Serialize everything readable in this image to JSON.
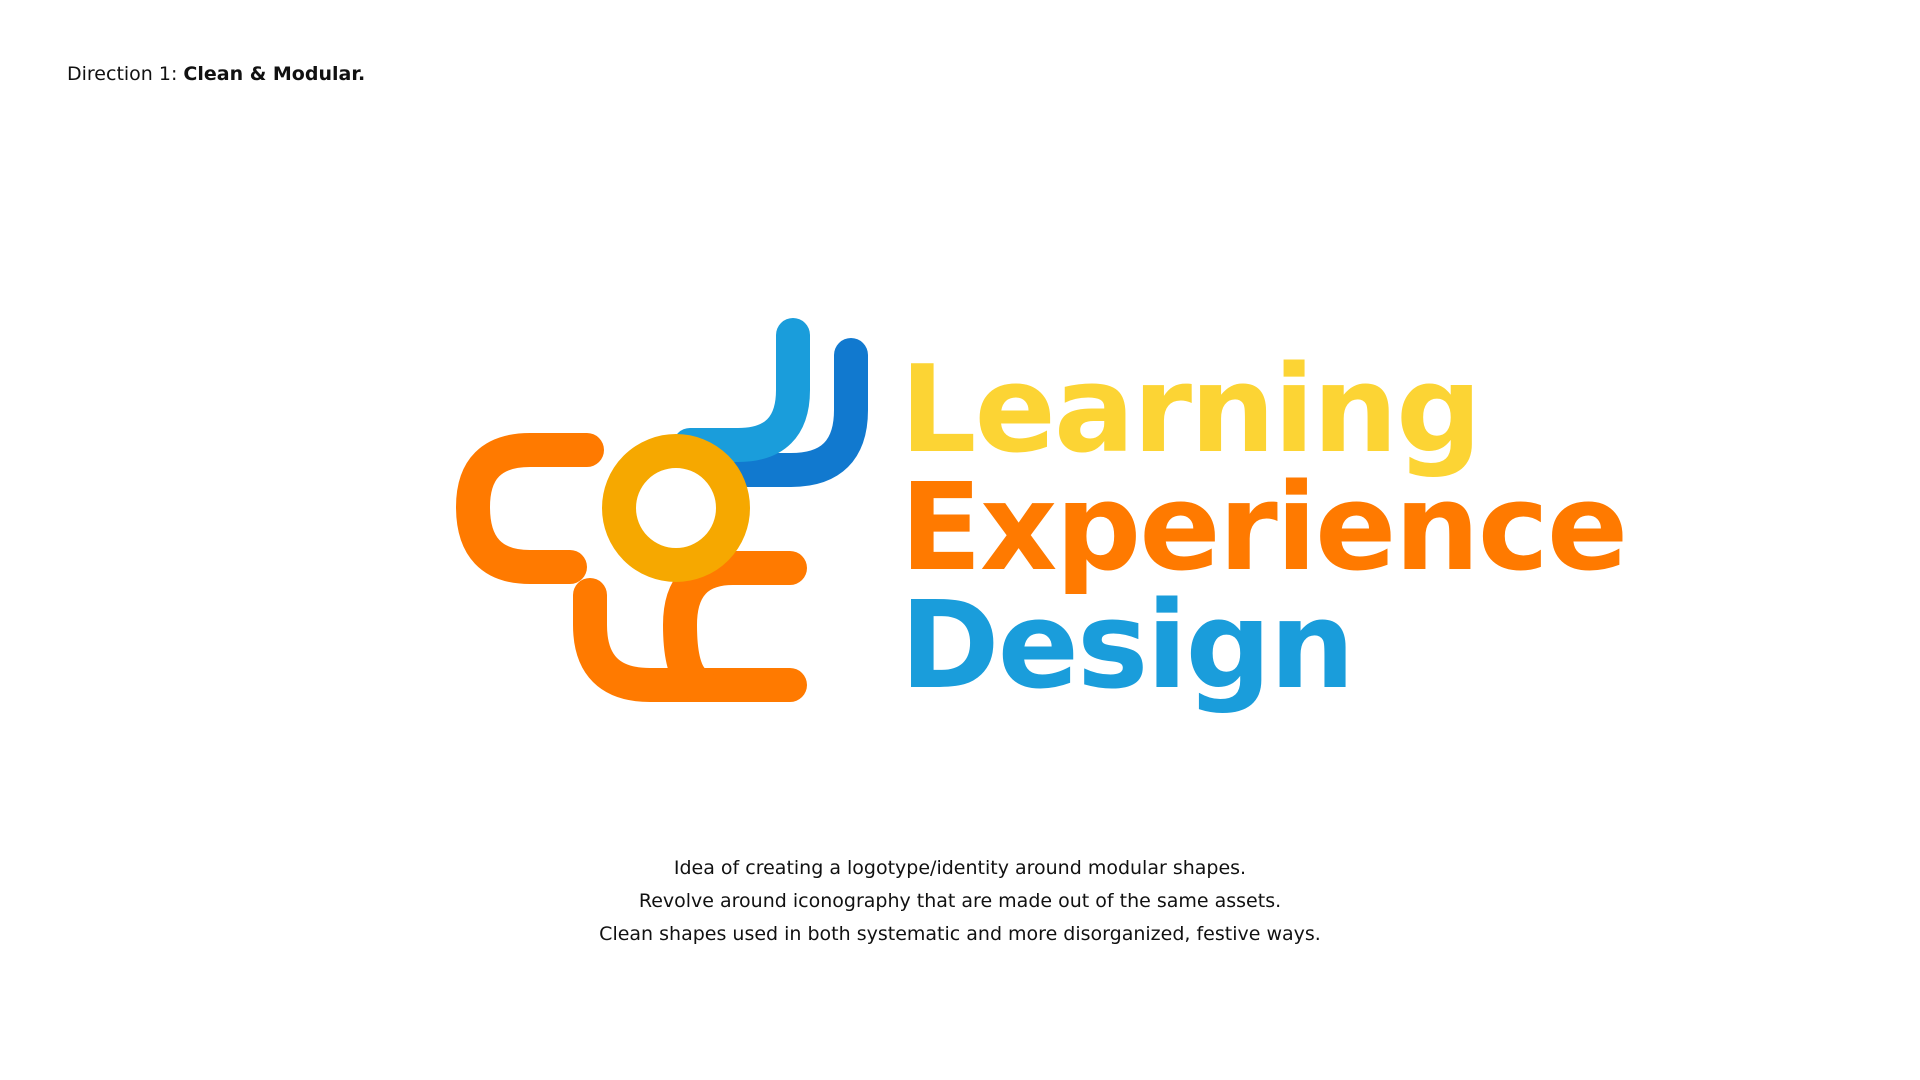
{
  "header": {
    "direction_prefix": "Direction 1: ",
    "direction_name": "Clean & Modular."
  },
  "logo": {
    "line1": "Learning",
    "line2": "Experience",
    "line3": "Design",
    "colors": {
      "yellow": "#FCD434",
      "orange": "#FF7A00",
      "light_blue": "#1A9DDB",
      "dark_blue": "#1179CF",
      "amber": "#F6A800"
    }
  },
  "description": {
    "lines": [
      "Idea of creating a logotype/identity around modular shapes.",
      "Revolve around iconography that are made out of the same assets.",
      "Clean shapes used in both systematic and more disorganized, festive ways."
    ]
  }
}
